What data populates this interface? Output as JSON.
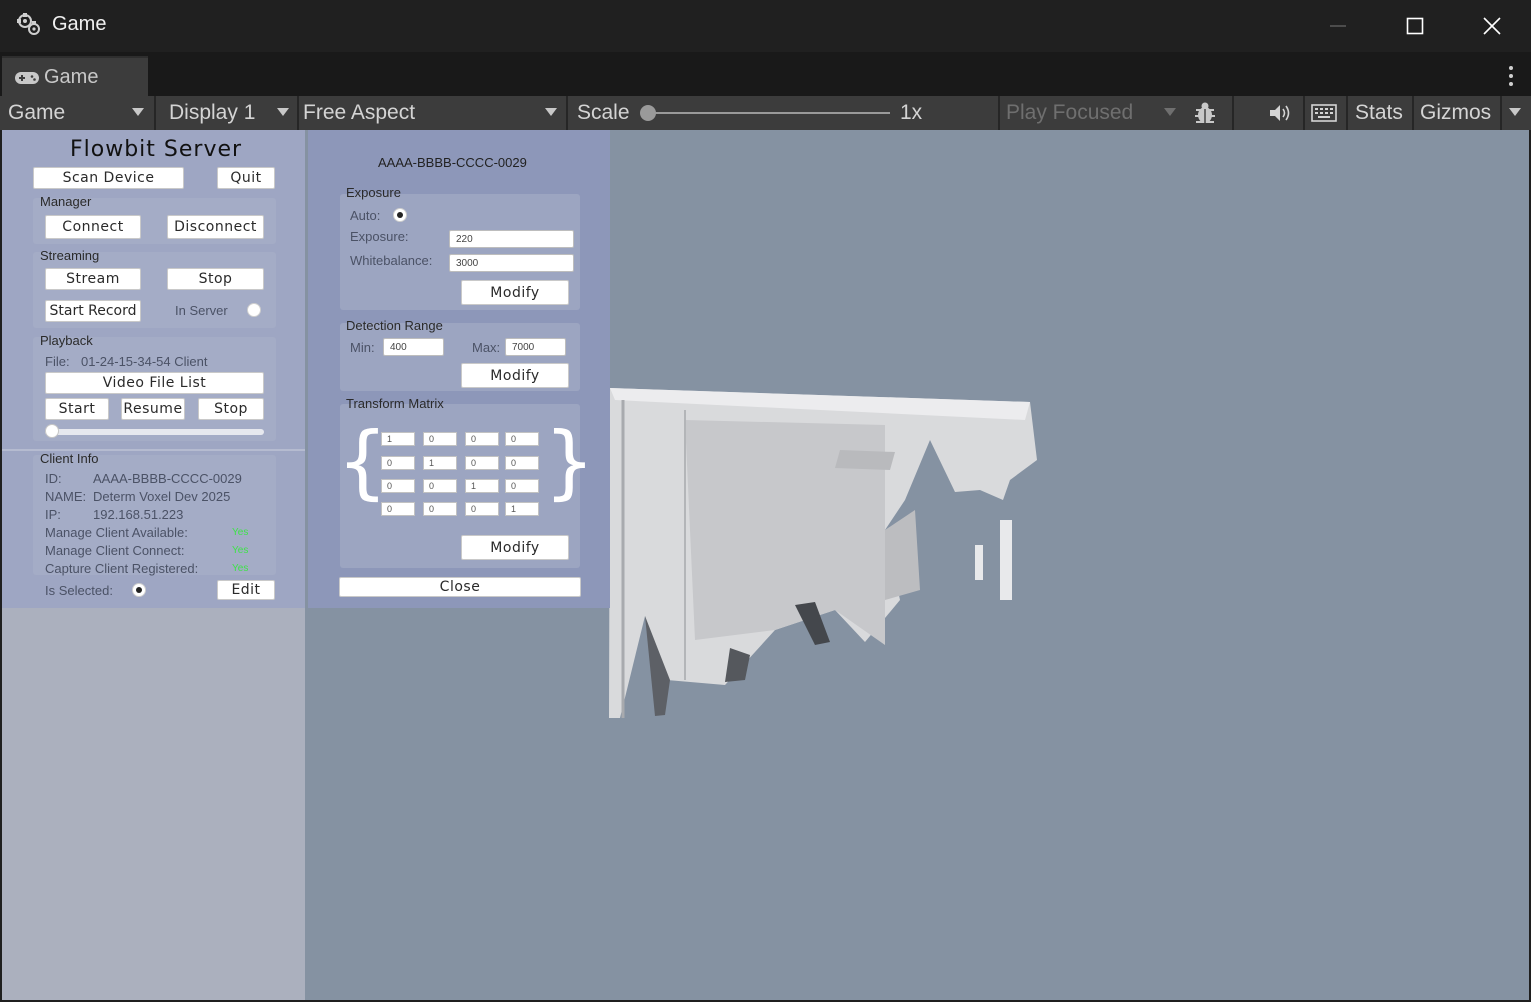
{
  "window": {
    "title": "Game"
  },
  "tab": {
    "label": "Game"
  },
  "toolbar": {
    "view_mode": "Game",
    "display": "Display 1",
    "aspect": "Free Aspect",
    "scale_label": "Scale",
    "scale_value": "1x",
    "play_mode": "Play Focused",
    "stats_label": "Stats",
    "gizmos_label": "Gizmos"
  },
  "left_panel": {
    "title": "Flowbit Server",
    "scan_device": "Scan Device",
    "quit": "Quit",
    "manager": {
      "label": "Manager",
      "connect": "Connect",
      "disconnect": "Disconnect"
    },
    "streaming": {
      "label": "Streaming",
      "stream": "Stream",
      "stop": "Stop",
      "start_record": "Start Record",
      "in_server_label": "In Server",
      "in_server_checked": false
    },
    "playback": {
      "label": "Playback",
      "file_label": "File:",
      "file_value": "01-24-15-34-54 Client",
      "video_file_list": "Video File List",
      "start": "Start",
      "resume": "Resume",
      "stop": "Stop",
      "progress": 0
    },
    "client_info": {
      "label": "Client Info",
      "id_label": "ID:",
      "id_value": "AAAA-BBBB-CCCC-0029",
      "name_label": "NAME:",
      "name_value": "Determ Voxel Dev 2025",
      "ip_label": "IP:",
      "ip_value": "192.168.51.223",
      "manage_available_label": "Manage Client Available:",
      "manage_available_value": "Yes",
      "manage_connect_label": "Manage Client Connect:",
      "manage_connect_value": "Yes",
      "capture_registered_label": "Capture Client Registered:",
      "capture_registered_value": "Yes",
      "is_selected_label": "Is Selected:",
      "is_selected": true,
      "edit": "Edit"
    }
  },
  "device_panel": {
    "device_id": "AAAA-BBBB-CCCC-0029",
    "exposure": {
      "label": "Exposure",
      "auto_label": "Auto:",
      "auto": true,
      "exposure_label": "Exposure:",
      "exposure_value": "220",
      "whitebalance_label": "Whitebalance:",
      "whitebalance_value": "3000",
      "modify": "Modify"
    },
    "detection_range": {
      "label": "Detection Range",
      "min_label": "Min:",
      "min_value": "400",
      "max_label": "Max:",
      "max_value": "7000",
      "modify": "Modify"
    },
    "transform": {
      "label": "Transform Matrix",
      "matrix": [
        [
          "1",
          "0",
          "0",
          "0"
        ],
        [
          "0",
          "1",
          "0",
          "0"
        ],
        [
          "0",
          "0",
          "1",
          "0"
        ],
        [
          "0",
          "0",
          "0",
          "1"
        ]
      ],
      "modify": "Modify"
    },
    "close": "Close"
  },
  "colors": {
    "viewport": "#8592a2",
    "panel": "#9ea6c3",
    "yes_green": "#3fe24a"
  }
}
